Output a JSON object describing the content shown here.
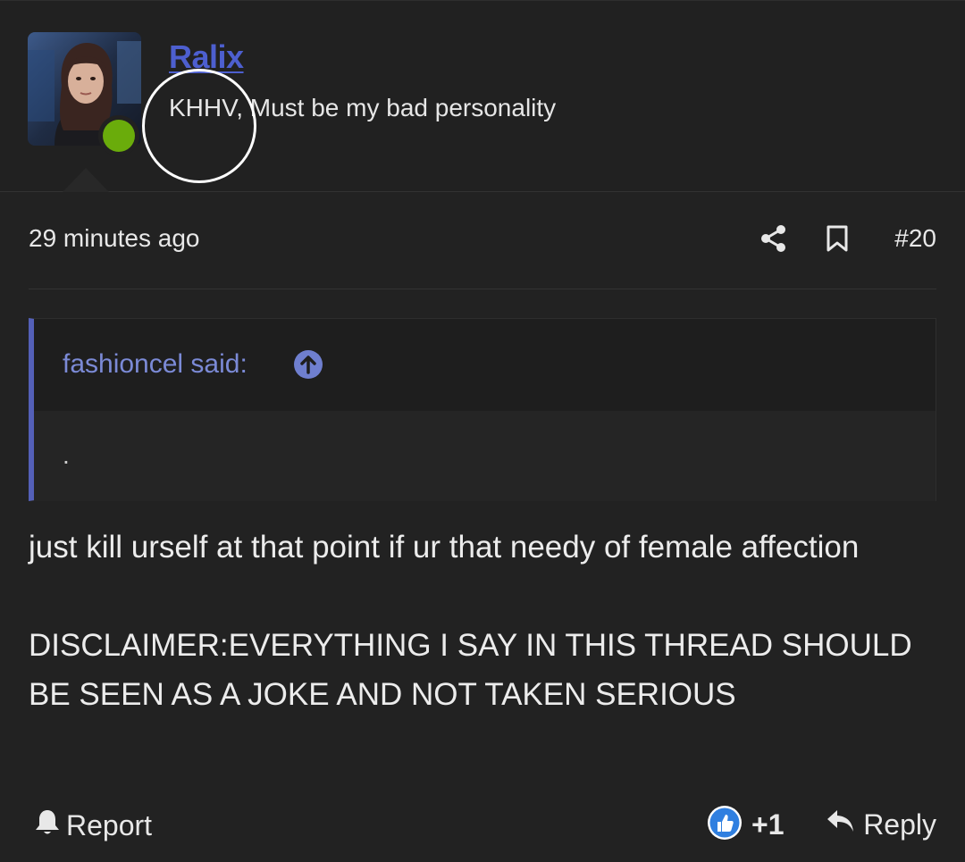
{
  "user": {
    "name": "Ralix",
    "title": "KHHV, Must be my bad personality",
    "status": "online",
    "colors": {
      "name": "#4d5fcf",
      "online": "#6aac0b"
    }
  },
  "post": {
    "timestamp": "29 minutes ago",
    "number": "#20",
    "icons": [
      "share-icon",
      "bookmark-icon"
    ]
  },
  "quote": {
    "author_label": "fashioncel said:",
    "text": ".",
    "icon": "arrow-up-circle-icon",
    "colors": {
      "bar": "#5460b8",
      "author": "#7b8ad6"
    }
  },
  "body": {
    "paragraph_1": "just kill urself at that point if ur that needy of female affection",
    "paragraph_2": "DISCLAIMER:EVERYTHING I SAY IN THIS THREAD SHOULD BE SEEN AS A JOKE AND NOT TAKEN SERIOUS"
  },
  "footer": {
    "report_label": "Report",
    "reaction_count": "+1",
    "reply_label": "Reply",
    "icons": [
      "bell-icon",
      "thumbs-up-icon",
      "reply-arrow-icon"
    ]
  }
}
